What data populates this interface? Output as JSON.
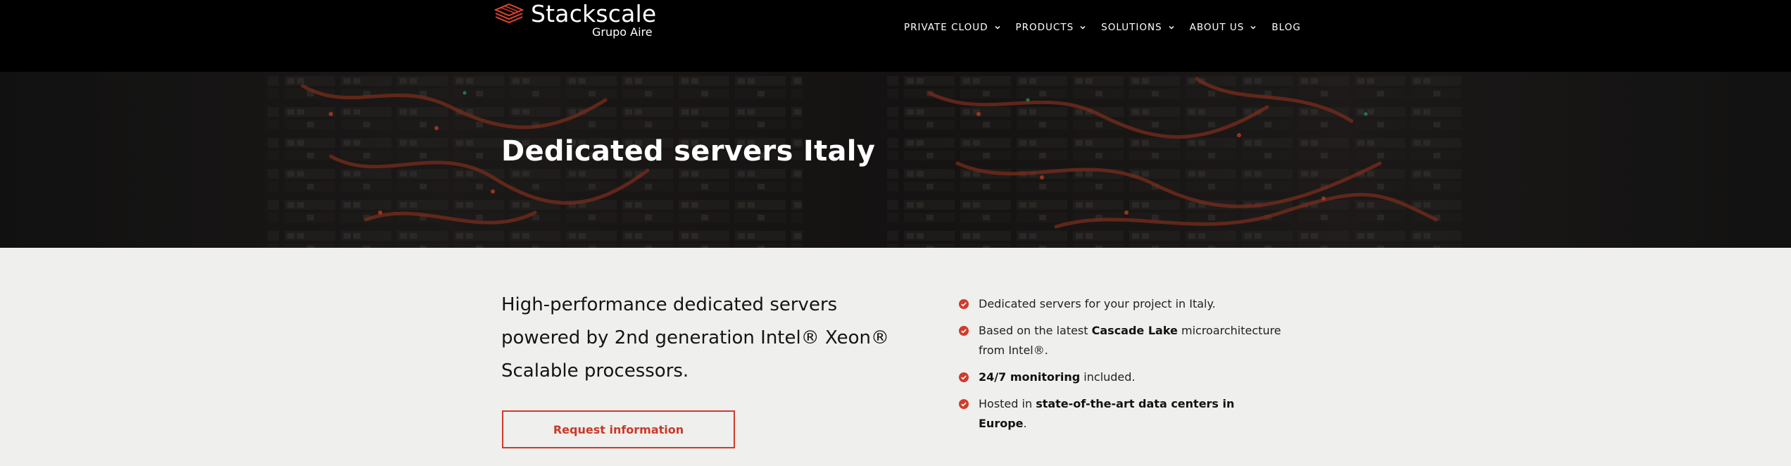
{
  "brand": {
    "name": "Stackscale",
    "subtitle": "Grupo Aire",
    "accent_color": "#e0452f"
  },
  "nav": {
    "items": [
      {
        "label": "PRIVATE CLOUD",
        "has_dropdown": true
      },
      {
        "label": "PRODUCTS",
        "has_dropdown": true
      },
      {
        "label": "SOLUTIONS",
        "has_dropdown": true
      },
      {
        "label": "ABOUT US",
        "has_dropdown": true
      },
      {
        "label": "BLOG",
        "has_dropdown": false
      }
    ]
  },
  "hero": {
    "title": "Dedicated servers Italy"
  },
  "intro": {
    "text": "High-performance dedicated servers powered by 2nd generation Intel® Xeon® Scalable processors."
  },
  "cta": {
    "label": "Request information"
  },
  "features": [
    {
      "before": "Dedicated servers for your project in Italy.",
      "bold": "",
      "after": ""
    },
    {
      "before": "Based on the latest ",
      "bold": "Cascade Lake",
      "after": " microarchitecture from Intel®."
    },
    {
      "before": "",
      "bold": "24/7 monitoring",
      "after": " included."
    },
    {
      "before": "Hosted in ",
      "bold": "state-of-the-art data centers in Europe",
      "after": "."
    }
  ],
  "icons": {
    "logo": "layered-stack-logo-icon",
    "dropdown": "chevron-down-icon",
    "check": "check-circle-icon"
  }
}
